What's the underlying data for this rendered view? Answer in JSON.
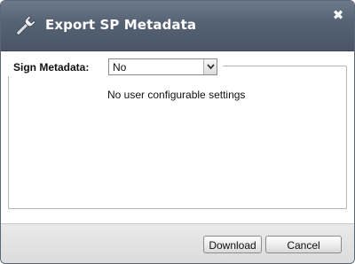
{
  "dialog": {
    "title": "Export SP Metadata",
    "title_icon": "wrench-icon",
    "close_icon": "close-icon",
    "close_glyph": "✖"
  },
  "form": {
    "sign_metadata_label": "Sign Metadata:",
    "sign_metadata_value": "No",
    "dropdown_icon": "chevron-down-icon",
    "info_text": "No user configurable settings"
  },
  "footer": {
    "download_label": "Download",
    "cancel_label": "Cancel"
  },
  "colors": {
    "titlebar": "#556273",
    "title_text": "#ffffff",
    "footer": "#e2e2e2"
  }
}
